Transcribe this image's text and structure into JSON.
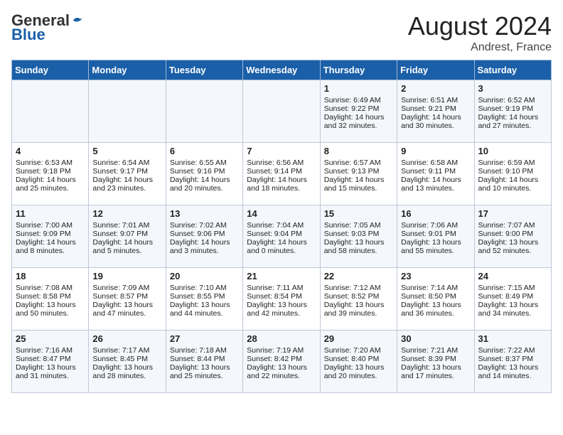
{
  "logo": {
    "general": "General",
    "blue": "Blue"
  },
  "title": {
    "month_year": "August 2024",
    "location": "Andrest, France"
  },
  "days_of_week": [
    "Sunday",
    "Monday",
    "Tuesday",
    "Wednesday",
    "Thursday",
    "Friday",
    "Saturday"
  ],
  "weeks": [
    [
      {
        "day": "",
        "data": ""
      },
      {
        "day": "",
        "data": ""
      },
      {
        "day": "",
        "data": ""
      },
      {
        "day": "",
        "data": ""
      },
      {
        "day": "1",
        "data": "Sunrise: 6:49 AM\nSunset: 9:22 PM\nDaylight: 14 hours\nand 32 minutes."
      },
      {
        "day": "2",
        "data": "Sunrise: 6:51 AM\nSunset: 9:21 PM\nDaylight: 14 hours\nand 30 minutes."
      },
      {
        "day": "3",
        "data": "Sunrise: 6:52 AM\nSunset: 9:19 PM\nDaylight: 14 hours\nand 27 minutes."
      }
    ],
    [
      {
        "day": "4",
        "data": "Sunrise: 6:53 AM\nSunset: 9:18 PM\nDaylight: 14 hours\nand 25 minutes."
      },
      {
        "day": "5",
        "data": "Sunrise: 6:54 AM\nSunset: 9:17 PM\nDaylight: 14 hours\nand 23 minutes."
      },
      {
        "day": "6",
        "data": "Sunrise: 6:55 AM\nSunset: 9:16 PM\nDaylight: 14 hours\nand 20 minutes."
      },
      {
        "day": "7",
        "data": "Sunrise: 6:56 AM\nSunset: 9:14 PM\nDaylight: 14 hours\nand 18 minutes."
      },
      {
        "day": "8",
        "data": "Sunrise: 6:57 AM\nSunset: 9:13 PM\nDaylight: 14 hours\nand 15 minutes."
      },
      {
        "day": "9",
        "data": "Sunrise: 6:58 AM\nSunset: 9:11 PM\nDaylight: 14 hours\nand 13 minutes."
      },
      {
        "day": "10",
        "data": "Sunrise: 6:59 AM\nSunset: 9:10 PM\nDaylight: 14 hours\nand 10 minutes."
      }
    ],
    [
      {
        "day": "11",
        "data": "Sunrise: 7:00 AM\nSunset: 9:09 PM\nDaylight: 14 hours\nand 8 minutes."
      },
      {
        "day": "12",
        "data": "Sunrise: 7:01 AM\nSunset: 9:07 PM\nDaylight: 14 hours\nand 5 minutes."
      },
      {
        "day": "13",
        "data": "Sunrise: 7:02 AM\nSunset: 9:06 PM\nDaylight: 14 hours\nand 3 minutes."
      },
      {
        "day": "14",
        "data": "Sunrise: 7:04 AM\nSunset: 9:04 PM\nDaylight: 14 hours\nand 0 minutes."
      },
      {
        "day": "15",
        "data": "Sunrise: 7:05 AM\nSunset: 9:03 PM\nDaylight: 13 hours\nand 58 minutes."
      },
      {
        "day": "16",
        "data": "Sunrise: 7:06 AM\nSunset: 9:01 PM\nDaylight: 13 hours\nand 55 minutes."
      },
      {
        "day": "17",
        "data": "Sunrise: 7:07 AM\nSunset: 9:00 PM\nDaylight: 13 hours\nand 52 minutes."
      }
    ],
    [
      {
        "day": "18",
        "data": "Sunrise: 7:08 AM\nSunset: 8:58 PM\nDaylight: 13 hours\nand 50 minutes."
      },
      {
        "day": "19",
        "data": "Sunrise: 7:09 AM\nSunset: 8:57 PM\nDaylight: 13 hours\nand 47 minutes."
      },
      {
        "day": "20",
        "data": "Sunrise: 7:10 AM\nSunset: 8:55 PM\nDaylight: 13 hours\nand 44 minutes."
      },
      {
        "day": "21",
        "data": "Sunrise: 7:11 AM\nSunset: 8:54 PM\nDaylight: 13 hours\nand 42 minutes."
      },
      {
        "day": "22",
        "data": "Sunrise: 7:12 AM\nSunset: 8:52 PM\nDaylight: 13 hours\nand 39 minutes."
      },
      {
        "day": "23",
        "data": "Sunrise: 7:14 AM\nSunset: 8:50 PM\nDaylight: 13 hours\nand 36 minutes."
      },
      {
        "day": "24",
        "data": "Sunrise: 7:15 AM\nSunset: 8:49 PM\nDaylight: 13 hours\nand 34 minutes."
      }
    ],
    [
      {
        "day": "25",
        "data": "Sunrise: 7:16 AM\nSunset: 8:47 PM\nDaylight: 13 hours\nand 31 minutes."
      },
      {
        "day": "26",
        "data": "Sunrise: 7:17 AM\nSunset: 8:45 PM\nDaylight: 13 hours\nand 28 minutes."
      },
      {
        "day": "27",
        "data": "Sunrise: 7:18 AM\nSunset: 8:44 PM\nDaylight: 13 hours\nand 25 minutes."
      },
      {
        "day": "28",
        "data": "Sunrise: 7:19 AM\nSunset: 8:42 PM\nDaylight: 13 hours\nand 22 minutes."
      },
      {
        "day": "29",
        "data": "Sunrise: 7:20 AM\nSunset: 8:40 PM\nDaylight: 13 hours\nand 20 minutes."
      },
      {
        "day": "30",
        "data": "Sunrise: 7:21 AM\nSunset: 8:39 PM\nDaylight: 13 hours\nand 17 minutes."
      },
      {
        "day": "31",
        "data": "Sunrise: 7:22 AM\nSunset: 8:37 PM\nDaylight: 13 hours\nand 14 minutes."
      }
    ]
  ]
}
